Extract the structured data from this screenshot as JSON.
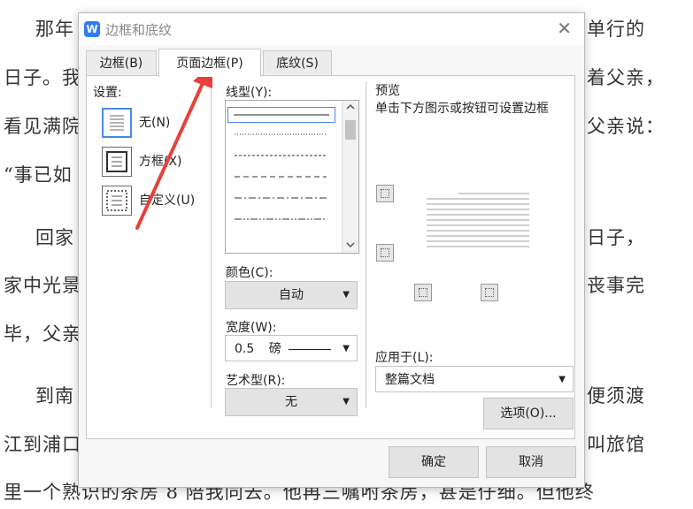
{
  "document": {
    "lines": [
      "那年",
      "单行的",
      "日子。我",
      "着父亲，",
      "看见满院",
      "父亲说：",
      "“事已如",
      "回家",
      "日子，",
      "家中光景",
      "丧事完",
      "毕，父亲",
      "到南",
      "便须渡",
      "江到浦口",
      "叫旅馆",
      "里一个熟识的茶房 8 陪我同去。他再三嘱咐茶房，甚是仔细。但他终"
    ]
  },
  "dialog": {
    "app_icon": "W",
    "title": "边框和底纹",
    "close": "✕",
    "tabs": [
      "边框(B)",
      "页面边框(P)",
      "底纹(S)"
    ],
    "settings": {
      "label": "设置:",
      "items": [
        "无(N)",
        "方框(X)",
        "自定义(U)"
      ]
    },
    "line_style": {
      "label": "线型(Y):"
    },
    "color": {
      "label": "颜色(C):",
      "value": "自动"
    },
    "width": {
      "label": "宽度(W):",
      "value": "0.5",
      "unit": "磅"
    },
    "art": {
      "label": "艺术型(R):",
      "value": "无"
    },
    "preview": {
      "label": "预览",
      "note": "单击下方图示或按钮可设置边框"
    },
    "apply_to": {
      "label": "应用于(L):",
      "value": "整篇文档"
    },
    "options_button": "选项(O)...",
    "ok_button": "确定",
    "cancel_button": "取消"
  },
  "colors": {
    "accent": "#2f7bf5",
    "annotation_arrow": "#e8403a"
  }
}
